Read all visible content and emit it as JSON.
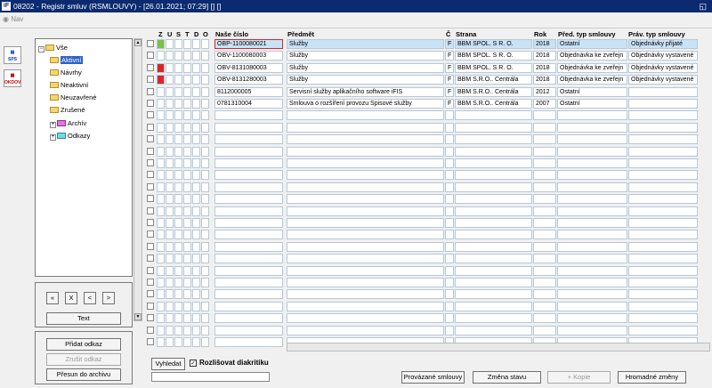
{
  "window": {
    "title": "08202 - Registr smluv (RSMLOUVY) - [26.01.2021; 07:29] [] []",
    "restore_icon": "restore-icon"
  },
  "navbar": {
    "nav_label": "Nav"
  },
  "sidetools": [
    "SPS",
    "OKDOV"
  ],
  "tree": {
    "root": "Vše",
    "items": [
      "Aktivní",
      "Návrhy",
      "Neaktivní",
      "Neuzavřené",
      "Zrušené",
      "Archív",
      "Odkazy"
    ]
  },
  "nav_buttons": {
    "first": "«",
    "clear": "X",
    "prev": "<",
    "next": ">",
    "text": "Text"
  },
  "actions": {
    "add_link": "Přidat odkaz",
    "cancel_link": "Zrušit odkaz",
    "move_archive": "Přesun do archivu"
  },
  "flags_header": [
    "Z",
    "U",
    "S",
    "T",
    "D",
    "O"
  ],
  "columns": {
    "number": "Naše číslo",
    "subject": "Předmět",
    "c": "Č",
    "party": "Strana",
    "year": "Rok",
    "pred_type": "Před. typ smlouvy",
    "prav_type": "Práv. typ smlouvy"
  },
  "rows": [
    {
      "number": "OBP-1100080021",
      "subject": "Služby",
      "c": "F",
      "party": "BBM SPOL. S R. O.",
      "year": "2018",
      "pred_type": "Ostatní",
      "prav_type": "Objednávky přijaté",
      "color": "#7ac142"
    },
    {
      "number": "OBV-1100080003",
      "subject": "Služby",
      "c": "F",
      "party": "BBM SPOL. S R. O.",
      "year": "2018",
      "pred_type": "Objednávka ke zveřejn",
      "prav_type": "Objednávky vystavené",
      "color": ""
    },
    {
      "number": "OBV-8131080003",
      "subject": "Služby",
      "c": "F",
      "party": "BBM SPOL. S R. O.",
      "year": "2018",
      "pred_type": "Objednávka ke zveřejn",
      "prav_type": "Objednávky vystavené",
      "color": "#d9262c"
    },
    {
      "number": "OBV-8131280003",
      "subject": "Služby",
      "c": "F",
      "party": "BBM S.R.O.. Centrála",
      "year": "2018",
      "pred_type": "Objednávka ke zveřejn",
      "prav_type": "Objednávky vystavené",
      "color": "#d9262c"
    },
    {
      "number": "8112000005",
      "subject": "Servisní služby aplikačního software iFIS",
      "c": "F",
      "party": "BBM S.R.O.. Centrála",
      "year": "2012",
      "pred_type": "Ostatní",
      "prav_type": "",
      "color": ""
    },
    {
      "number": "0781310004",
      "subject": "Smlouva o rozšíření provozu Spisové služby",
      "c": "F",
      "party": "BBM S.R.O.. Centrála",
      "year": "2007",
      "pred_type": "Ostatní",
      "prav_type": "",
      "color": ""
    }
  ],
  "empty_rows": 20,
  "search": {
    "button": "Vyhledat",
    "diacritics": "Rozlišovat diakritiku",
    "value": ""
  },
  "bottom_buttons": {
    "linked": "Provázané smlouvy",
    "change_state": "Změna stavu",
    "copy": "+ Kopie",
    "bulk": "Hromadné změny"
  }
}
